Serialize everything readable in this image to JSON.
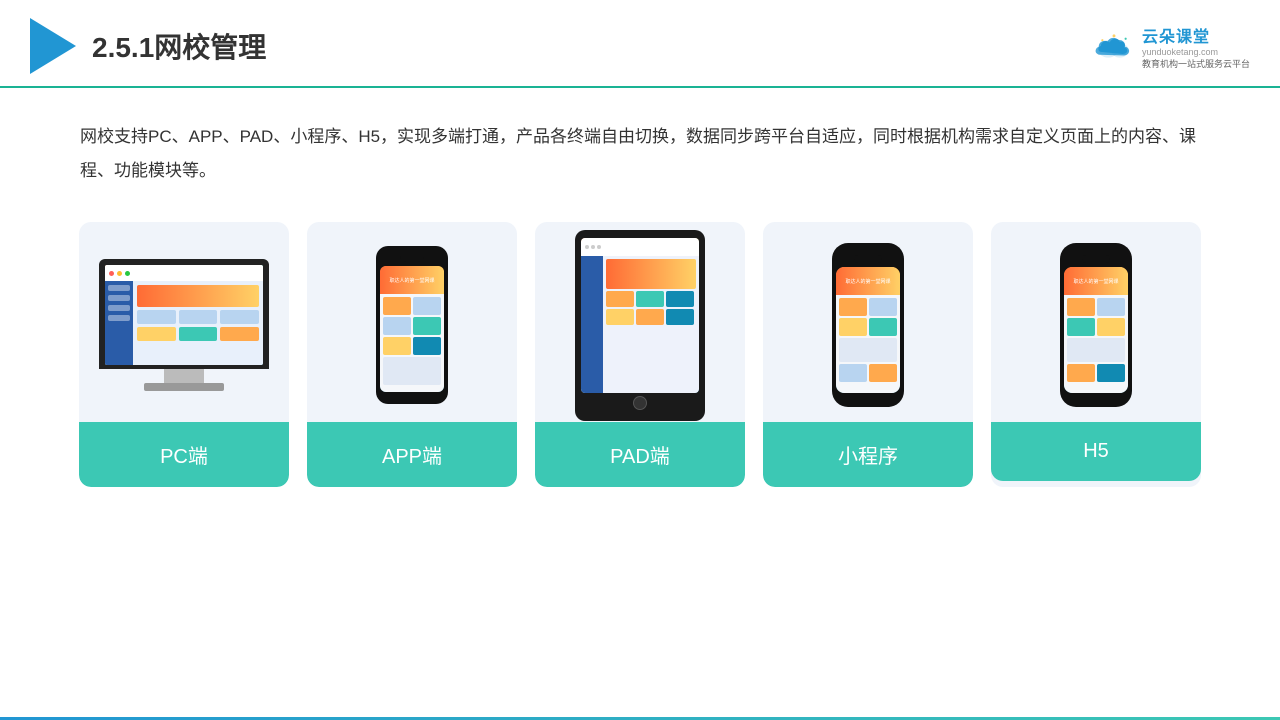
{
  "header": {
    "title": "2.5.1网校管理",
    "brand_name": "云朵课堂",
    "brand_url": "yunduoketang.com",
    "brand_subtitle": "教育机构一站式服务云平台"
  },
  "description": {
    "text": "网校支持PC、APP、PAD、小程序、H5，实现多端打通，产品各终端自由切换，数据同步跨平台自适应，同时根据机构需求自定义页面上的内容、课程、功能模块等。"
  },
  "cards": [
    {
      "label": "PC端",
      "type": "pc"
    },
    {
      "label": "APP端",
      "type": "phone"
    },
    {
      "label": "PAD端",
      "type": "tablet"
    },
    {
      "label": "小程序",
      "type": "phone2"
    },
    {
      "label": "H5",
      "type": "phone3"
    }
  ],
  "colors": {
    "accent": "#3cc8b4",
    "blue": "#2196d3",
    "header_border": "#1ab394"
  }
}
